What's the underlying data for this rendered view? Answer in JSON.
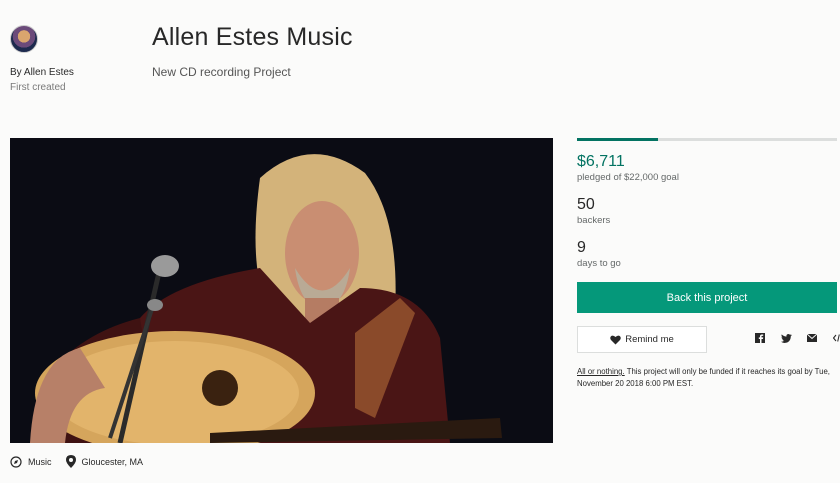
{
  "creator": {
    "byline": "By Allen Estes",
    "created_label": "First created"
  },
  "project": {
    "title": "Allen Estes Music",
    "subtitle": "New CD recording Project",
    "category": "Music",
    "location": "Gloucester, MA"
  },
  "stats": {
    "pledged": "$6,711",
    "pledged_label": "pledged of $22,000 goal",
    "funded_fraction": 0.31,
    "backers": "50",
    "backers_label": "backers",
    "days": "9",
    "days_label": "days to go"
  },
  "actions": {
    "back_label": "Back this project",
    "remind_label": "Remind me",
    "accent_color": "#05987a"
  },
  "social_icons": [
    "facebook-icon",
    "twitter-icon",
    "email-icon",
    "embed-icon"
  ],
  "funding_note": {
    "link": "All or nothing.",
    "text": " This project will only be funded if it reaches its goal by Tue, November 20 2018 6:00 PM EST."
  }
}
